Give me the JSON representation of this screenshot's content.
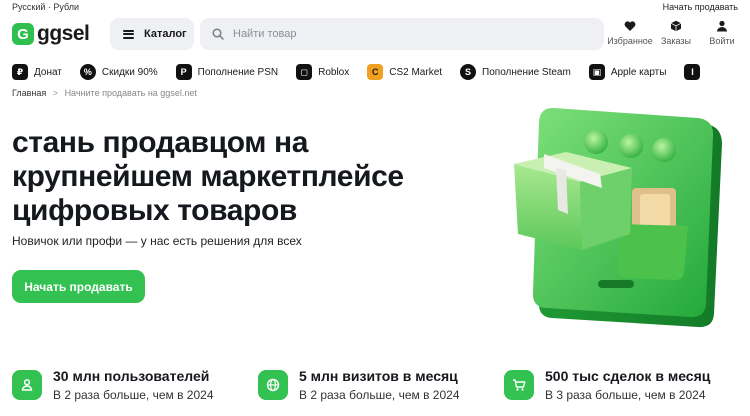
{
  "topbar": {
    "lang": "Русский · Рубли",
    "start_selling": "Начать продавать"
  },
  "header": {
    "logo_letter": "G",
    "logo_text": "ggsel",
    "catalog_label": "Каталог",
    "search_placeholder": "Найти товар",
    "actions": [
      {
        "label": "Избранное",
        "icon": "heart-icon"
      },
      {
        "label": "Заказы",
        "icon": "box-icon"
      },
      {
        "label": "Войти",
        "icon": "user-icon"
      }
    ]
  },
  "categories": [
    {
      "label": "Донат",
      "icon": "donate-icon",
      "glyph": "₽"
    },
    {
      "label": "Скидки 90%",
      "icon": "discount-icon",
      "glyph": "%"
    },
    {
      "label": "Пополнение PSN",
      "icon": "psn-icon",
      "glyph": "P"
    },
    {
      "label": "Roblox",
      "icon": "roblox-icon",
      "glyph": "◻"
    },
    {
      "label": "CS2 Market",
      "icon": "cs2-icon",
      "glyph": "C"
    },
    {
      "label": "Пополнение Steam",
      "icon": "steam-icon",
      "glyph": "S"
    },
    {
      "label": "Apple карты",
      "icon": "gift-card-icon",
      "glyph": "▣"
    },
    {
      "label": "I",
      "icon": "more-icon",
      "glyph": "I"
    }
  ],
  "breadcrumb": {
    "home": "Главная",
    "separator": ">",
    "current": "Начните продавать на ggsel.net"
  },
  "hero": {
    "title_lines": [
      "стань продавцом на",
      "крупнейшем маркетплейсе",
      "цифровых товаров"
    ],
    "subtitle": "Новичок или профи — у нас есть решения для всех",
    "cta_label": "Начать продавать"
  },
  "stats": [
    {
      "title": "30 млн пользователей",
      "subtitle": "В 2 раза больше, чем в 2024",
      "icon": "user-icon"
    },
    {
      "title": "5 млн визитов в месяц",
      "subtitle": "В 2 раза больше, чем в 2024",
      "icon": "globe-icon"
    },
    {
      "title": "500 тыс сделок в месяц",
      "subtitle": "В 3 раза больше, чем в 2024",
      "icon": "cart-icon"
    }
  ],
  "colors": {
    "brand_green": "#33c252",
    "text_dark": "#15181d",
    "field_bg": "#eef0f3"
  }
}
